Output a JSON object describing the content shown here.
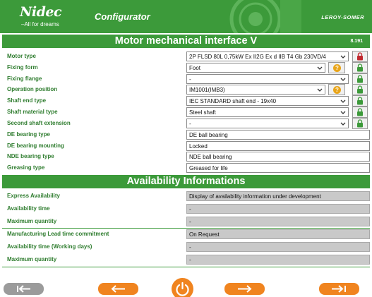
{
  "header": {
    "logo": "Nidec",
    "tagline": "–All for dreams",
    "app_title": "Configurator",
    "brand": "LEROY-SOMER",
    "color_green": "#3c9a3a",
    "color_orange": "#f0841f"
  },
  "mechanical": {
    "title": "Motor mechanical interface V",
    "version": "8.191",
    "rows": [
      {
        "label": "Motor type",
        "value": "2P FLSD 80L 0,75kW Ex II2G Ex d IIB T4 Gb 230VD/4",
        "kind": "select",
        "help": false,
        "lock": "red-lock-icon"
      },
      {
        "label": "Fixing form",
        "value": "Foot",
        "kind": "select-short",
        "help": true,
        "lock": "green-lock-icon"
      },
      {
        "label": "Fixing flange",
        "value": "-",
        "kind": "select",
        "help": false,
        "lock": "green-lock-icon"
      },
      {
        "label": "Operation position",
        "value": "IM1001(IMB3)",
        "kind": "select-short",
        "help": true,
        "lock": "green-lock-icon"
      },
      {
        "label": "Shaft end type",
        "value": "IEC STANDARD shaft end - 19x40",
        "kind": "select",
        "help": false,
        "lock": "green-lock-icon"
      },
      {
        "label": "Shaft material type",
        "value": "Steel shaft",
        "kind": "select",
        "help": false,
        "lock": "green-lock-icon"
      },
      {
        "label": "Second shaft extension",
        "value": "-",
        "kind": "select",
        "help": false,
        "lock": "green-lock-icon"
      },
      {
        "label": "DE bearing type",
        "value": "DE ball bearing",
        "kind": "readonly"
      },
      {
        "label": "DE bearing mounting",
        "value": "Locked",
        "kind": "readonly"
      },
      {
        "label": "NDE bearing type",
        "value": "NDE ball bearing",
        "kind": "readonly"
      },
      {
        "label": "Greasing type",
        "value": "Greased for life",
        "kind": "readonly"
      }
    ]
  },
  "availability": {
    "title": "Availability Informations",
    "rows": [
      {
        "label": "Express Availability",
        "value": "Display of availability information under development"
      },
      {
        "label": "Availability time",
        "value": "-"
      },
      {
        "label": "Maximum quantity",
        "value": "-"
      },
      {
        "label": "Manufacturing Lead time commitment",
        "value": "On Request"
      },
      {
        "label": "Availability time (Working days)",
        "value": "-"
      },
      {
        "label": "Maximum quantity",
        "value": "-"
      }
    ]
  },
  "footer": {
    "buttons": [
      "first-page-icon",
      "previous-icon",
      "power-icon",
      "next-icon",
      "last-page-icon"
    ]
  }
}
